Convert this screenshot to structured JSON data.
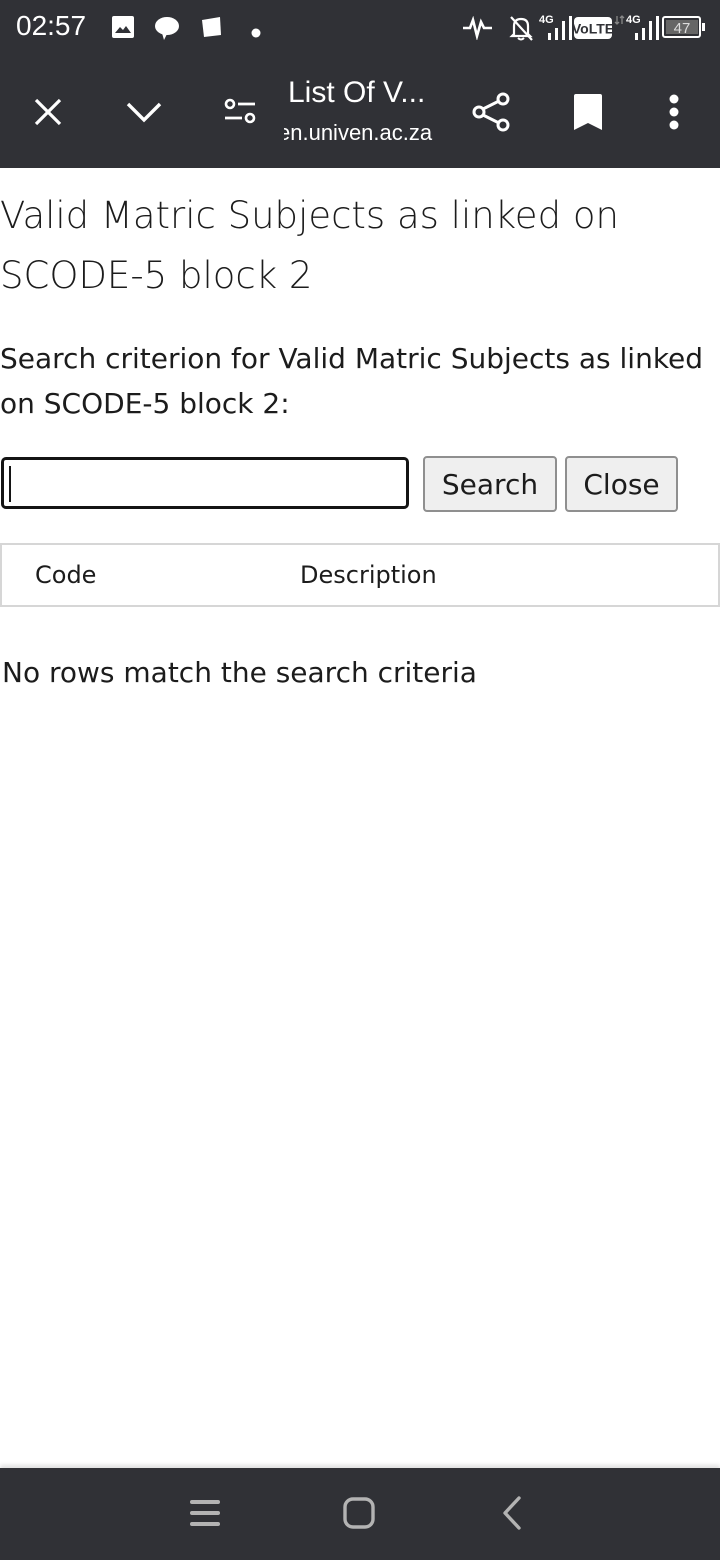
{
  "status_bar": {
    "time": "02:57",
    "notification_icons": [
      "gallery-icon",
      "chat-bubble-icon",
      "notes-icon",
      "dot-icon"
    ],
    "right_icons": [
      "activity-icon",
      "bell-off-icon",
      "signal-4g-icon",
      "volte-icon",
      "signal-4g-icon",
      "battery-icon"
    ],
    "network_1": "4G",
    "volte": "VoLTE",
    "network_2": "4G",
    "battery": "47"
  },
  "toolbar": {
    "title": "List Of V...",
    "url": "en.univen.ac.za",
    "icons": [
      "close-icon",
      "chevron-down-icon",
      "site-settings-icon",
      "share-icon",
      "bookmark-icon",
      "more-vert-icon"
    ]
  },
  "page": {
    "heading": "Valid Matric Subjects as linked on SCODE-5 block 2",
    "criterion_label": "Search criterion for Valid Matric Subjects as linked on SCODE-5 block 2:",
    "search_value": "",
    "search_button": "Search",
    "close_button": "Close",
    "table": {
      "columns": [
        "Code",
        "Description"
      ],
      "rows": []
    },
    "empty_message": "No rows match the search criteria"
  },
  "nav_bar": {
    "icons": [
      "recents-icon",
      "home-icon",
      "back-icon"
    ]
  }
}
